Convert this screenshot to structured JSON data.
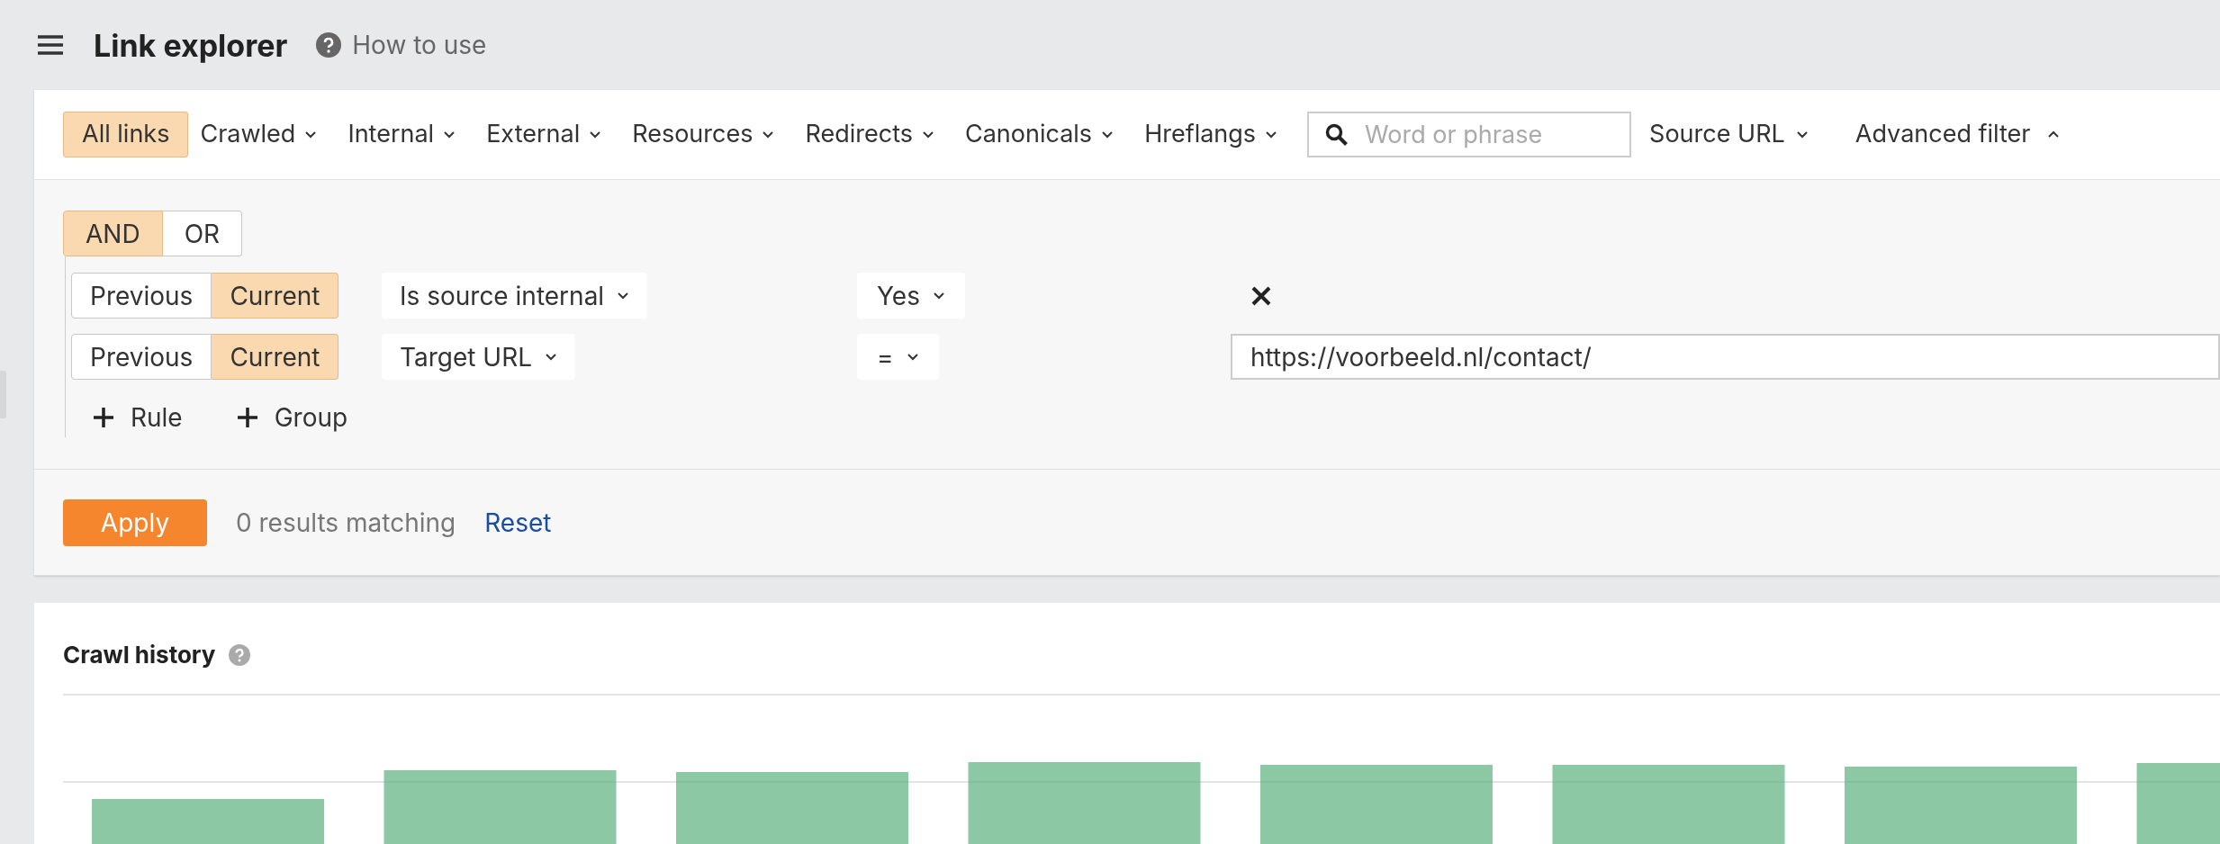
{
  "header": {
    "title": "Link explorer",
    "help_link": "How to use"
  },
  "tabs": [
    {
      "label": "All links",
      "selected": true,
      "dropdown": false
    },
    {
      "label": "Crawled",
      "selected": false,
      "dropdown": true
    },
    {
      "label": "Internal",
      "selected": false,
      "dropdown": true
    },
    {
      "label": "External",
      "selected": false,
      "dropdown": true
    },
    {
      "label": "Resources",
      "selected": false,
      "dropdown": true
    },
    {
      "label": "Redirects",
      "selected": false,
      "dropdown": true
    },
    {
      "label": "Canonicals",
      "selected": false,
      "dropdown": true
    },
    {
      "label": "Hreflangs",
      "selected": false,
      "dropdown": true
    }
  ],
  "search": {
    "placeholder": "Word or phrase"
  },
  "source_url": {
    "label": "Source URL"
  },
  "advanced_filter": {
    "label": "Advanced filter",
    "expanded": true
  },
  "filter": {
    "logic": [
      {
        "label": "AND",
        "selected": true
      },
      {
        "label": "OR",
        "selected": false
      }
    ],
    "rules": [
      {
        "kind": "boolean",
        "period": [
          {
            "label": "Previous",
            "selected": false
          },
          {
            "label": "Current",
            "selected": true
          }
        ],
        "field": "Is source internal",
        "operator": "Yes"
      },
      {
        "kind": "text",
        "period": [
          {
            "label": "Previous",
            "selected": false
          },
          {
            "label": "Current",
            "selected": true
          }
        ],
        "field": "Target URL",
        "operator": "=",
        "value": "https://voorbeeld.nl/contact/"
      }
    ],
    "add_buttons": [
      "Rule",
      "Group"
    ],
    "apply": "Apply",
    "result_count": "0 results matching",
    "reset": "Reset"
  },
  "crawl_history": {
    "title": "Crawl history"
  }
}
